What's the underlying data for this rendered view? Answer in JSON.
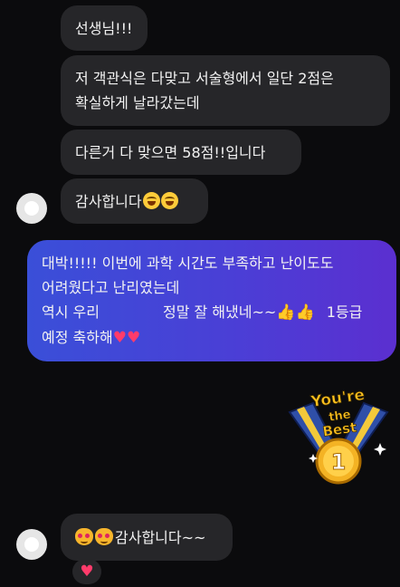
{
  "messages": [
    {
      "lines": [
        "선생님!!!"
      ]
    },
    {
      "lines": [
        "저 객관식은 다맞고 서술형에서 일단 2점은",
        "확실하게 날라갔는데"
      ]
    },
    {
      "lines": [
        "다른거 다 맞으면 58점!!입니다"
      ]
    },
    {
      "text": "감사합니다"
    },
    {
      "lines": [
        "대박!!!!! 이번에 과학 시간도 부족하고 난이도도",
        "어려웠다고 난리였는데"
      ],
      "line3_a": "역시 우리",
      "line3_b": "정말 잘 해냈네~~",
      "line3_c": "1등급",
      "line4": "예정 축하해"
    },
    {
      "text": "감사합니다~~"
    }
  ],
  "sticker": {
    "line1": "You're",
    "line2": "the",
    "line3": "Best",
    "number": "1"
  },
  "icons": {
    "avatar": "default-avatar-icon",
    "grin_emoji": "grinning-squinting-face-icon",
    "cat_emoji": "heart-eyes-cat-icon",
    "thumbs_emoji": "thumbs-up-icon",
    "heart_emoji": "red-heart-icon"
  },
  "colors": {
    "background": "#0b0b0d",
    "bubble": "#262629",
    "my_bubble_start": "#3a4fd8",
    "my_bubble_end": "#5b2fd0"
  }
}
